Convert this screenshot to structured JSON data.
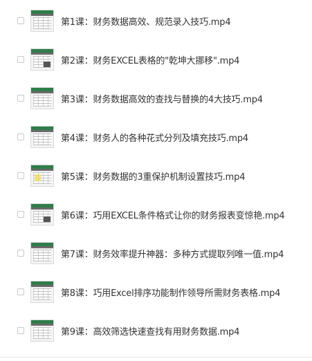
{
  "files": [
    {
      "name": "第1课：财务数据高效、规范录入技巧.mp4",
      "thumbnail_icon": "excel-video-thumbnail-icon"
    },
    {
      "name": "第2课：财务EXCEL表格的\"乾坤大挪移\".mp4",
      "thumbnail_icon": "excel-video-thumbnail-icon"
    },
    {
      "name": "第3课：财务数据高效的查找与替换的4大技巧.mp4",
      "thumbnail_icon": "excel-video-thumbnail-icon"
    },
    {
      "name": "第4课：财务人的各种花式分列及填充技巧.mp4",
      "thumbnail_icon": "excel-video-thumbnail-icon"
    },
    {
      "name": "第5课：财务数据的3重保护机制设置技巧.mp4",
      "thumbnail_icon": "excel-video-thumbnail-icon"
    },
    {
      "name": "第6课：巧用EXCEL条件格式让你的财务报表变惊艳.mp4",
      "thumbnail_icon": "excel-video-thumbnail-icon"
    },
    {
      "name": "第7课：财务效率提升神器：多种方式提取列唯一值.mp4",
      "thumbnail_icon": "excel-video-thumbnail-icon"
    },
    {
      "name": "第8课：巧用Excel排序功能制作领导所需财务表格.mp4",
      "thumbnail_icon": "excel-video-thumbnail-icon"
    },
    {
      "name": "第9课：高效筛选快速查找有用财务数据.mp4",
      "thumbnail_icon": "excel-video-thumbnail-icon"
    }
  ]
}
